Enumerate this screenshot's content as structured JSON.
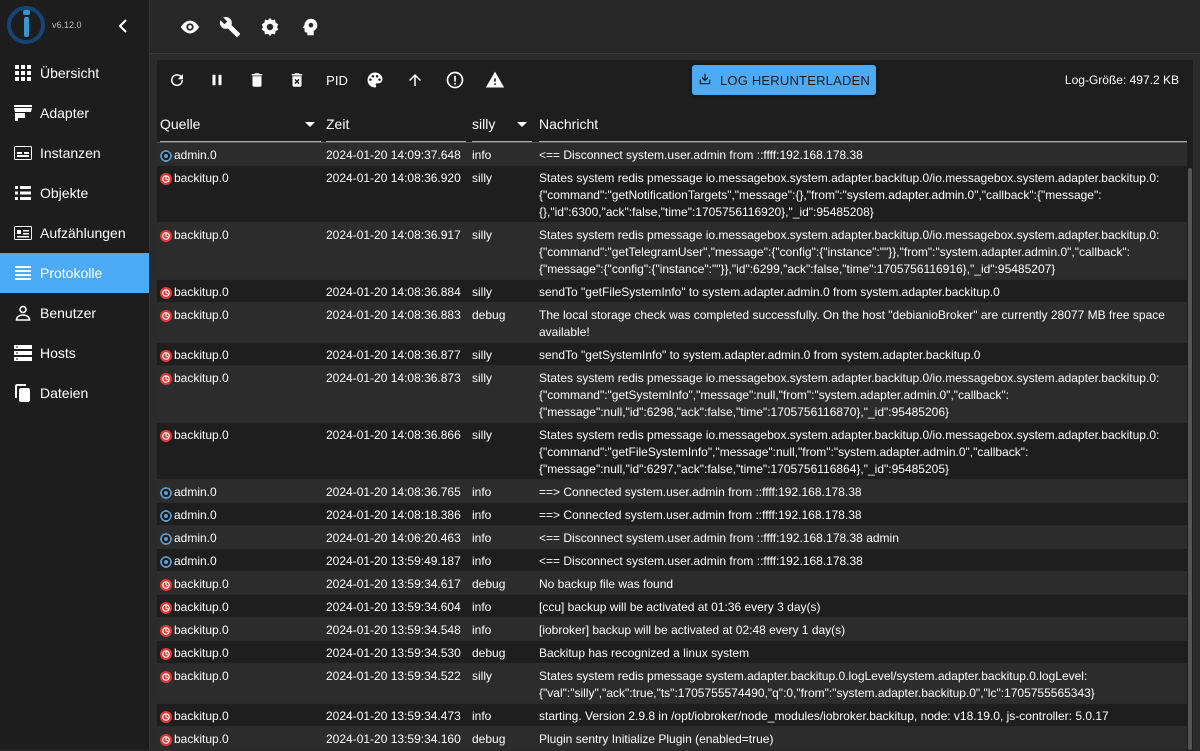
{
  "app": {
    "version": "v6.12.0"
  },
  "sidebar": {
    "items": [
      {
        "label": "Übersicht",
        "icon": "grid-icon",
        "active": false
      },
      {
        "label": "Adapter",
        "icon": "store-icon",
        "active": false
      },
      {
        "label": "Instanzen",
        "icon": "instances-icon",
        "active": false
      },
      {
        "label": "Objekte",
        "icon": "list-icon",
        "active": false
      },
      {
        "label": "Aufzählungen",
        "icon": "enum-icon",
        "active": false
      },
      {
        "label": "Protokolle",
        "icon": "log-icon",
        "active": true
      },
      {
        "label": "Benutzer",
        "icon": "user-icon",
        "active": false
      },
      {
        "label": "Hosts",
        "icon": "hosts-icon",
        "active": false
      },
      {
        "label": "Dateien",
        "icon": "files-icon",
        "active": false
      }
    ]
  },
  "toolbar": {
    "pid_label": "PID",
    "download_label": "LOG HERUNTERLADEN",
    "log_size": "Log-Größe: 497.2 KB"
  },
  "table": {
    "headers": {
      "source": "Quelle",
      "time": "Zeit",
      "severity": "silly",
      "message": "Nachricht"
    },
    "rows": [
      {
        "src": "admin.0",
        "type": "admin",
        "time": "2024-01-20 14:09:37.648",
        "sev": "info",
        "msg": "<== Disconnect system.user.admin from ::ffff:192.168.178.38",
        "lines": 1
      },
      {
        "src": "backitup.0",
        "type": "backitup",
        "time": "2024-01-20 14:08:36.920",
        "sev": "silly",
        "msg": "States system redis pmessage io.messagebox.system.adapter.backitup.0/io.messagebox.system.adapter.backitup.0: {\"command\":\"getNotificationTargets\",\"message\":{},\"from\":\"system.adapter.admin.0\",\"callback\":{\"message\": {},\"id\":6300,\"ack\":false,\"time\":1705756116920},\"_id\":95485208}",
        "lines": 3
      },
      {
        "src": "backitup.0",
        "type": "backitup",
        "time": "2024-01-20 14:08:36.917",
        "sev": "silly",
        "msg": "States system redis pmessage io.messagebox.system.adapter.backitup.0/io.messagebox.system.adapter.backitup.0: {\"command\":\"getTelegramUser\",\"message\":{\"config\":{\"instance\":\"\"}},\"from\":\"system.adapter.admin.0\",\"callback\": {\"message\":{\"config\":{\"instance\":\"\"}},\"id\":6299,\"ack\":false,\"time\":1705756116916},\"_id\":95485207}",
        "lines": 3
      },
      {
        "src": "backitup.0",
        "type": "backitup",
        "time": "2024-01-20 14:08:36.884",
        "sev": "silly",
        "msg": "sendTo \"getFileSystemInfo\" to system.adapter.admin.0 from system.adapter.backitup.0",
        "lines": 1
      },
      {
        "src": "backitup.0",
        "type": "backitup",
        "time": "2024-01-20 14:08:36.883",
        "sev": "debug",
        "msg": "The local storage check was completed successfully. On the host \"debianioBroker\" are currently 28077 MB free space available!",
        "lines": 2
      },
      {
        "src": "backitup.0",
        "type": "backitup",
        "time": "2024-01-20 14:08:36.877",
        "sev": "silly",
        "msg": "sendTo \"getSystemInfo\" to system.adapter.admin.0 from system.adapter.backitup.0",
        "lines": 1
      },
      {
        "src": "backitup.0",
        "type": "backitup",
        "time": "2024-01-20 14:08:36.873",
        "sev": "silly",
        "msg": "States system redis pmessage io.messagebox.system.adapter.backitup.0/io.messagebox.system.adapter.backitup.0: {\"command\":\"getSystemInfo\",\"message\":null,\"from\":\"system.adapter.admin.0\",\"callback\": {\"message\":null,\"id\":6298,\"ack\":false,\"time\":1705756116870},\"_id\":95485206}",
        "lines": 3
      },
      {
        "src": "backitup.0",
        "type": "backitup",
        "time": "2024-01-20 14:08:36.866",
        "sev": "silly",
        "msg": "States system redis pmessage io.messagebox.system.adapter.backitup.0/io.messagebox.system.adapter.backitup.0: {\"command\":\"getFileSystemInfo\",\"message\":null,\"from\":\"system.adapter.admin.0\",\"callback\": {\"message\":null,\"id\":6297,\"ack\":false,\"time\":1705756116864},\"_id\":95485205}",
        "lines": 3
      },
      {
        "src": "admin.0",
        "type": "admin",
        "time": "2024-01-20 14:08:36.765",
        "sev": "info",
        "msg": "==> Connected system.user.admin from ::ffff:192.168.178.38",
        "lines": 1
      },
      {
        "src": "admin.0",
        "type": "admin",
        "time": "2024-01-20 14:08:18.386",
        "sev": "info",
        "msg": "==> Connected system.user.admin from ::ffff:192.168.178.38",
        "lines": 1
      },
      {
        "src": "admin.0",
        "type": "admin",
        "time": "2024-01-20 14:06:20.463",
        "sev": "info",
        "msg": "<== Disconnect system.user.admin from ::ffff:192.168.178.38 admin",
        "lines": 1
      },
      {
        "src": "admin.0",
        "type": "admin",
        "time": "2024-01-20 13:59:49.187",
        "sev": "info",
        "msg": "<== Disconnect system.user.admin from ::ffff:192.168.178.38",
        "lines": 1
      },
      {
        "src": "backitup.0",
        "type": "backitup",
        "time": "2024-01-20 13:59:34.617",
        "sev": "debug",
        "msg": "No backup file was found",
        "lines": 1
      },
      {
        "src": "backitup.0",
        "type": "backitup",
        "time": "2024-01-20 13:59:34.604",
        "sev": "info",
        "msg": "[ccu] backup will be activated at 01:36 every 3 day(s)",
        "lines": 1
      },
      {
        "src": "backitup.0",
        "type": "backitup",
        "time": "2024-01-20 13:59:34.548",
        "sev": "info",
        "msg": "[iobroker] backup will be activated at 02:48 every 1 day(s)",
        "lines": 1
      },
      {
        "src": "backitup.0",
        "type": "backitup",
        "time": "2024-01-20 13:59:34.530",
        "sev": "debug",
        "msg": "Backitup has recognized a linux system",
        "lines": 1
      },
      {
        "src": "backitup.0",
        "type": "backitup",
        "time": "2024-01-20 13:59:34.522",
        "sev": "silly",
        "msg": "States system redis pmessage system.adapter.backitup.0.logLevel/system.adapter.backitup.0.logLevel: {\"val\":\"silly\",\"ack\":true,\"ts\":1705755574490,\"q\":0,\"from\":\"system.adapter.backitup.0\",\"lc\":1705755565343}",
        "lines": 2
      },
      {
        "src": "backitup.0",
        "type": "backitup",
        "time": "2024-01-20 13:59:34.473",
        "sev": "info",
        "msg": "starting. Version 2.9.8 in /opt/iobroker/node_modules/iobroker.backitup, node: v18.19.0, js-controller: 5.0.17",
        "lines": 1
      },
      {
        "src": "backitup.0",
        "type": "backitup",
        "time": "2024-01-20 13:59:34.160",
        "sev": "debug",
        "msg": "Plugin sentry Initialize Plugin (enabled=true)",
        "lines": 1
      }
    ]
  }
}
